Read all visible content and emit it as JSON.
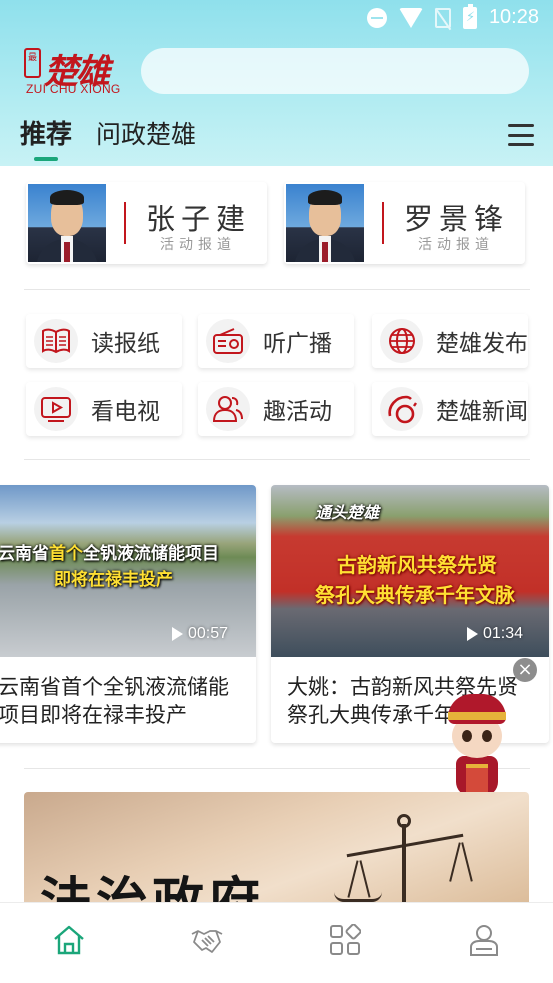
{
  "status_bar": {
    "time": "10:28"
  },
  "brand": {
    "seal": "最",
    "name": "楚雄",
    "subtitle": "ZUI CHU XIONG"
  },
  "search": {
    "placeholder": ""
  },
  "tabs": [
    {
      "label": "推荐",
      "active": true
    },
    {
      "label": "问政楚雄",
      "active": false
    }
  ],
  "leaders": [
    {
      "name": "张子建",
      "subtitle": "活动报道"
    },
    {
      "name": "罗景锋",
      "subtitle": "活动报道"
    }
  ],
  "services": [
    {
      "label": "读报纸",
      "icon": "newspaper-icon"
    },
    {
      "label": "听广播",
      "icon": "radio-icon"
    },
    {
      "label": "楚雄发布",
      "icon": "globe-icon"
    },
    {
      "label": "看电视",
      "icon": "tv-play-icon"
    },
    {
      "label": "趣活动",
      "icon": "people-icon"
    },
    {
      "label": "楚雄新闻",
      "icon": "news-logo-icon"
    }
  ],
  "videos": [
    {
      "overlay_line1_a": "云南省",
      "overlay_line1_b": "首个",
      "overlay_line1_c": "全钒液流储能项目",
      "overlay_line2": "即将在禄丰投产",
      "duration": "00:57",
      "title_line1": "云南省首个全钒液流储能",
      "title_line2": "项目即将在禄丰投产"
    },
    {
      "overlay_logo": "通头楚雄",
      "overlay_line1": "古韵新风共祭先贤",
      "overlay_line2": "祭孔大典传承千年文脉",
      "duration": "01:34",
      "title_line1": "大姚：古韵新风共祭先贤",
      "title_line2": "祭孔大典传承千年"
    }
  ],
  "banner": {
    "title": "法治政府"
  },
  "bottom_nav": [
    {
      "icon": "home-icon",
      "active": true
    },
    {
      "icon": "handshake-icon",
      "active": false
    },
    {
      "icon": "apps-grid-icon",
      "active": false
    },
    {
      "icon": "user-profile-icon",
      "active": false
    }
  ],
  "colors": {
    "brand_red": "#c2161d",
    "accent_green": "#1ba67a",
    "header_cyan": "#8fe0ec"
  }
}
